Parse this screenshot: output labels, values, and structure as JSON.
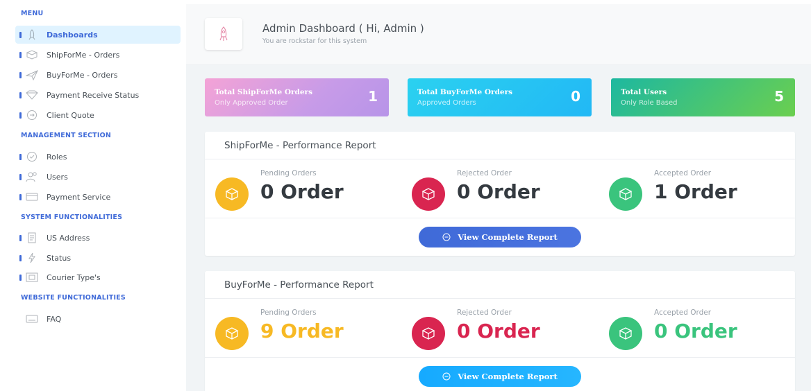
{
  "sidebar": {
    "sections": {
      "menu": "MENU",
      "management": "MANAGEMENT SECTION",
      "system": "SYSTEM FUNCTIONALITIES",
      "website": "WEBSITE FUNCTIONALITIES"
    },
    "items": {
      "dashboards": "Dashboards",
      "shipforme_orders": "ShipForMe - Orders",
      "buyforme_orders": "BuyForMe - Orders",
      "payment_receive_status": "Payment Receive Status",
      "client_quote": "Client Quote",
      "roles": "Roles",
      "users": "Users",
      "payment_service": "Payment Service",
      "us_address": "US Address",
      "status": "Status",
      "courier_types": "Courier Type's",
      "faq": "FAQ"
    }
  },
  "header": {
    "title": "Admin Dashboard ( Hi, Admin )",
    "subtitle": "You are rockstar for this system"
  },
  "stats": [
    {
      "title": "Total ShipForMe Orders",
      "subtitle": "Only Approved Order",
      "value": "1"
    },
    {
      "title": "Total BuyForMe Orders",
      "subtitle": "Approved Orders",
      "value": "0"
    },
    {
      "title": "Total Users",
      "subtitle": "Only Role Based",
      "value": "5"
    }
  ],
  "shipforme_report": {
    "title": "ShipForMe - Performance Report",
    "pending_label": "Pending Orders",
    "pending_value": "0 Order",
    "rejected_label": "Rejected Order",
    "rejected_value": "0 Order",
    "accepted_label": "Accepted Order",
    "accepted_value": "1 Order",
    "button_label": "View Complete Report"
  },
  "buyforme_report": {
    "title": "BuyForMe - Performance Report",
    "pending_label": "Pending Orders",
    "pending_value": "9 Order",
    "rejected_label": "Rejected Order",
    "rejected_value": "0 Order",
    "accepted_label": "Accepted Order",
    "accepted_value": "0 Order",
    "button_label": "View Complete Report"
  },
  "colors": {
    "accent": "#3f6ad8",
    "warning": "#f7b924",
    "danger": "#d92550",
    "success": "#3ac47d",
    "primary_button": "#3f6ad8",
    "info_button": "#16aaff"
  },
  "icons": {
    "header": "rocket-icon",
    "metric": "box-icon",
    "button": "circle-arrow-icon"
  }
}
